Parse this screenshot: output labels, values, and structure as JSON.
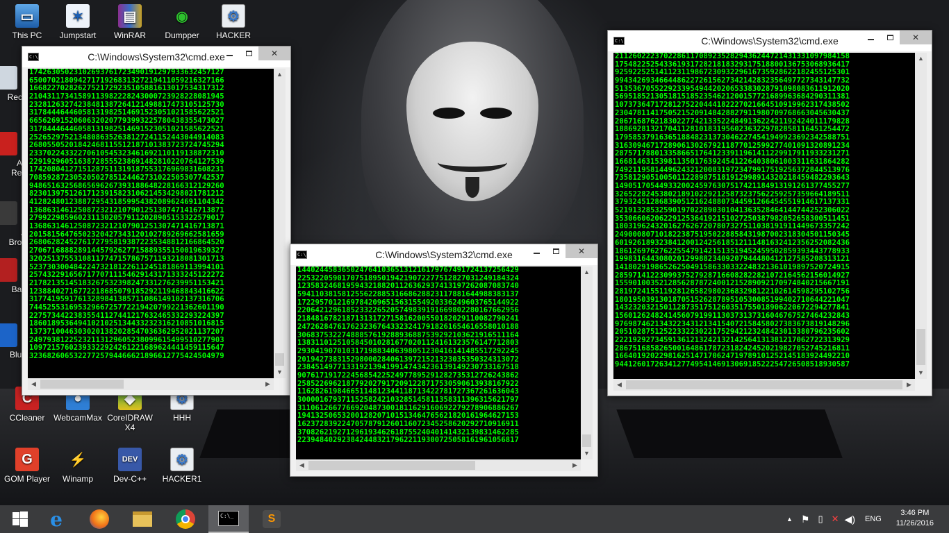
{
  "desktop_icons": [
    {
      "label": "This PC",
      "icon": "this-pc-icon"
    },
    {
      "label": "Jumpstart",
      "icon": "jumpstart-icon"
    },
    {
      "label": "WinRAR",
      "icon": "winrar-icon"
    },
    {
      "label": "Dumpper",
      "icon": "dumpper-icon"
    },
    {
      "label": "HACKER",
      "icon": "hacker-icon"
    },
    {
      "label": "CCleaner",
      "icon": "ccleaner-icon"
    },
    {
      "label": "WebcamMax",
      "icon": "webcammax-icon"
    },
    {
      "label": "CoreIDRAW X4",
      "icon": "coreldraw-icon"
    },
    {
      "label": "HHH",
      "icon": "hhh-icon"
    },
    {
      "label": "GOM Player",
      "icon": "gom-player-icon"
    },
    {
      "label": "Winamp",
      "icon": "winamp-icon"
    },
    {
      "label": "Dev-C++",
      "icon": "devcpp-icon"
    },
    {
      "label": "HACKER1",
      "icon": "hacker1-icon"
    }
  ],
  "partial_icons": [
    "Recy",
    "Ac",
    "Rea",
    "A",
    "Broa",
    "Ban",
    "Blue"
  ],
  "windows": {
    "left": {
      "title": "C:\\Windows\\System32\\cmd.exe",
      "lines": [
        "17426305023102693761723490191297933632457127",
        "65007021809427171926831327219411059216327166",
        "16682270282627521729235105881613017534317312",
        "21043117341589113982228243000723928228081945",
        "23281263274238481387264121498817473105125730",
        "31784446446058131982514691523051021585622521",
        "66562691520606320207793993225780438355473027",
        "31784446446058131982514691523051021585622521",
        "25265297521348086352638127241152443044914083",
        "26805505201842468115512187101383723724745294",
        "23370224332270610545323461692110119138872310",
        "22919296051638728555238691482810220764127539",
        "17420804127151287511319187553176969831608231",
        "70859287230520502785124462731022505307742537",
        "94865163256865696267393188648228166312129260",
        "82301397512617123915823106214534298021781212",
        "41282480123887295431859954382089624691104342",
        "13686314612508723212107901251307471416713871",
        "27992298596023113020579112028905153322579017",
        "13686314612508723212107901251307471416713871",
        "20158156476502320427343120102789269662581659",
        "26806282452761727958193872235348812166864520",
        "27067168882891445792627715889355150019639327",
        "32025137553108117747157867571193218081301713",
        "52373030048422473218122611245181869113994101",
        "25743229165671770711154629143171333245122272",
        "21782135145183267532398247331276239951153421",
        "12388402716772218685079185292119468843416622",
        "31774195917613289841385711086149102137316706",
        "74452553169532966725772219420799221362601190",
        "22757344223835541127441217632465332293224397",
        "18601895364941021025134433232316210851016815",
        "13737100463030201382028547036362952021137207",
        "24979381225232113129605238099615499510277903",
        "10972157602393322924261221689624441459115647",
        "32368260653227725794466621896612775424504979"
      ]
    },
    "right": {
      "title": "C:\\Windows\\System32\\cmd.exe",
      "lines": [
        "21126022237022861170892352829436244721431331097984158",
        "17548225254336193172821818329317518800136753068936417",
        "92592252514112311986723093229616735928622182455125301",
        "99434269346644862272615627342142832356497727343147732",
        "51353670552292339549442020653383028791098083611912020",
        "56951852130518151852354621200157721689963684290311381",
        "10737364717281275220444182227021664510919962317438502",
        "23047811417505215209148428827911980709768663045630437",
        "20671687621830227742133522484913622421192424011179828",
        "18869281321704112810183195602363229782858116451254472",
        "17958537916365188482313730462274541949923692342588751",
        "31630946717289061302679211877012599277401091320891234",
        "28757178801335866517641233911961411229917911933231271",
        "16681463153981135017639245412264038061003311631864282",
        "74921195814496243212008319723479917519256372844513976",
        "73581290510050112289875181912998914320218459482293643",
        "14905170544933200245976307517421184913191261377455277",
        "32652282453802189102292125873237562259257359664189511",
        "37932451286839051216248807344591266454551914617137331",
        "52191328532590197022890301041363528464144744252306022",
        "35306606206229125364192151027250387982052658300511451",
        "18031962432016276267207807327511038191911449673357242",
        "24900080710182238751950228858431987002318304501150345",
        "60192618932384120012425618512111481632412356252082436",
        "18612697627622554791421513519452459502859393443778933",
        "19983164430802012998823409207944480412127585208313121",
        "14180291986526250491586330332248321361019897520724915",
        "28597141223099375279287166082822821072164562156014927",
        "15590100352128562878724001215289092170974840215667191",
        "28197241551192812658298023683298122102614598295102756",
        "18019503913018705152628789510530085199402710644221047",
        "14323203215011287351751260351755018906220672294277841",
        "15601262482414560791991130373137316046767527464232843",
        "97698746213432234312134154072158458027383673819148296",
        "20510287512522332230221752942123248423013380796235602",
        "22219292734591361213242132142564131381217062722313929",
        "28675168582650016486178723182424520219827052745216811",
        "16640192022981625147170624719789101252145183924492210",
        "94412601726341277495414691306918522254726508518930587"
      ]
    },
    "middle": {
      "title": "C:\\Windows\\System32\\cmd.exe",
      "lines": [
        "14402445836502476410365131216179767491724137256429",
        "22532205901707518950194219072277512827031249184324",
        "12358324681959432188201126362937413197262087083740",
        "59411038158125562288531668628823117881644988383137",
        "17229570121697842096515631554920336249603765144922",
        "22064212961852332265205749839191669802280167662956",
        "21848167821871313172715816200550182029110082790241",
        "24726284761762323676433232417918261654616558010188",
        "30683753227488857619288936887539292103621916511164",
        "13831101251058450102816770201124161323576147712803",
        "29304190701031719883406398051230416141485517292245",
        "20194273831529800028406139721521323035350324313072",
        "23845149771331921394199147434236139149230733167518",
        "90761719172245685422524977895291282735312726243862",
        "25852269621877920279172091228717530590613938167922",
        "11628261984665114812344118713422781727367261636043",
        "30000167937115258242103285145811358311396315621797",
        "31106126677669204873001811629160692279278906886267",
        "19413250653200128207101513464765621820161964627153",
        "16237283922470578791260116072345258620292710916911",
        "37082621927129619346261875524040141432139831462285",
        "22394840292384244832179622119300725058161961056817"
      ]
    }
  },
  "taskbar": {
    "apps": [
      "windows-start-icon",
      "internet-explorer-icon",
      "firefox-icon",
      "file-explorer-icon",
      "chrome-icon",
      "cmd-icon",
      "sublime-icon"
    ],
    "language": "ENG",
    "time": "3:46 PM",
    "date": "11/26/2016"
  }
}
